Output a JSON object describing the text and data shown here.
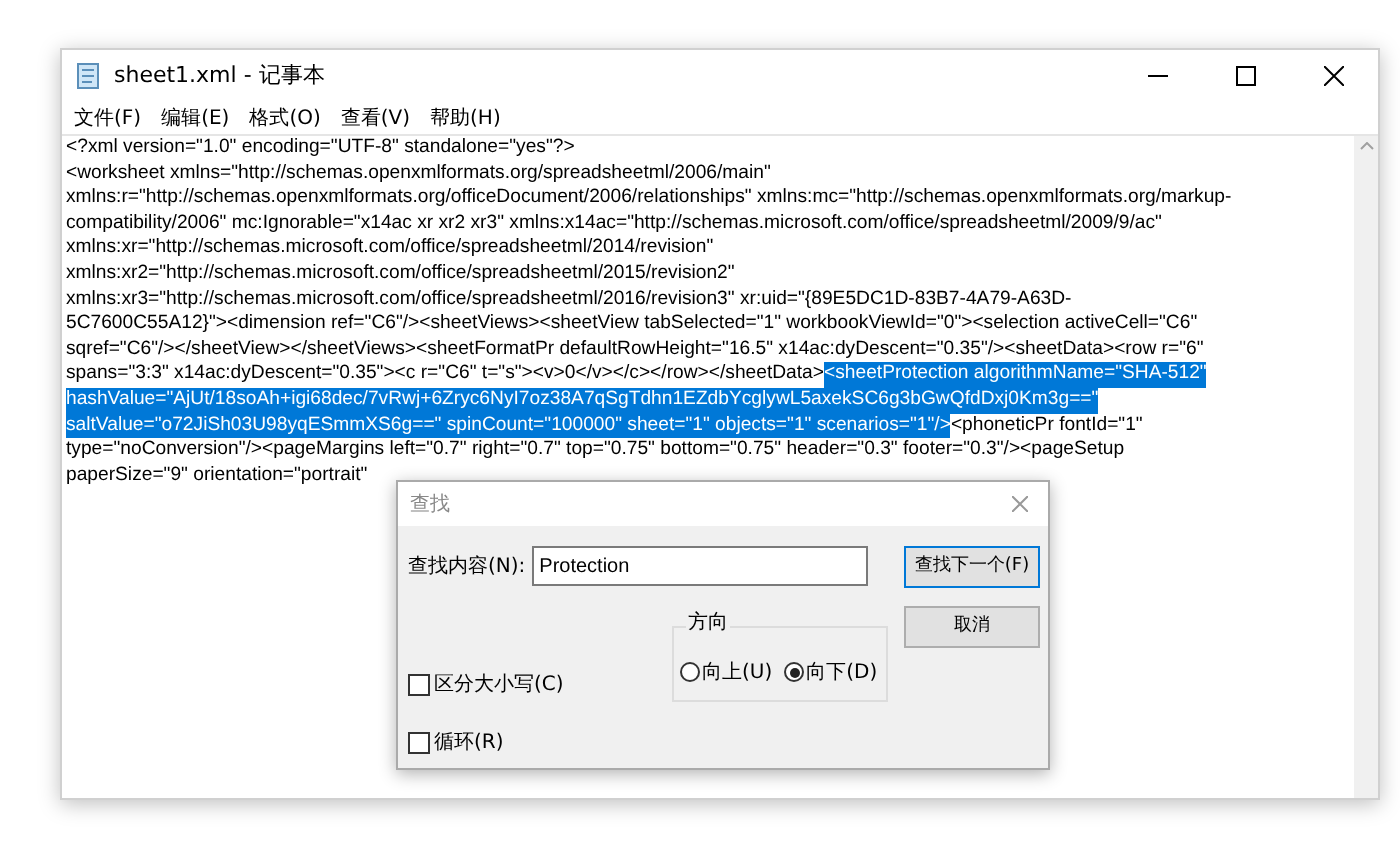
{
  "window": {
    "title": "sheet1.xml - 记事本"
  },
  "menu": [
    "文件(F)",
    "编辑(E)",
    "格式(O)",
    "查看(V)",
    "帮助(H)"
  ],
  "editor": {
    "lines": [
      [
        {
          "text": "<?xml version=\"1.0\" encoding=\"UTF-8\" standalone=\"yes\"?>",
          "selected": false
        }
      ],
      [
        {
          "text": "<worksheet xmlns=\"http://schemas.openxmlformats.org/spreadsheetml/2006/main\"",
          "selected": false
        }
      ],
      [
        {
          "text": "xmlns:r=\"http://schemas.openxmlformats.org/officeDocument/2006/relationships\" xmlns:mc=\"http://schemas.openxmlformats.org/markup-",
          "selected": false
        }
      ],
      [
        {
          "text": "compatibility/2006\" mc:Ignorable=\"x14ac xr xr2 xr3\" xmlns:x14ac=\"http://schemas.microsoft.com/office/spreadsheetml/2009/9/ac\"",
          "selected": false
        }
      ],
      [
        {
          "text": "xmlns:xr=\"http://schemas.microsoft.com/office/spreadsheetml/2014/revision\"",
          "selected": false
        }
      ],
      [
        {
          "text": "xmlns:xr2=\"http://schemas.microsoft.com/office/spreadsheetml/2015/revision2\"",
          "selected": false
        }
      ],
      [
        {
          "text": "xmlns:xr3=\"http://schemas.microsoft.com/office/spreadsheetml/2016/revision3\" xr:uid=\"{89E5DC1D-83B7-4A79-A63D-",
          "selected": false
        }
      ],
      [
        {
          "text": "5C7600C55A12}\"><dimension ref=\"C6\"/><sheetViews><sheetView tabSelected=\"1\" workbookViewId=\"0\"><selection activeCell=\"C6\"",
          "selected": false
        }
      ],
      [
        {
          "text": "sqref=\"C6\"/></sheetView></sheetViews><sheetFormatPr defaultRowHeight=\"16.5\" x14ac:dyDescent=\"0.35\"/><sheetData><row r=\"6\"",
          "selected": false
        }
      ],
      [
        {
          "text": "spans=\"3:3\" x14ac:dyDescent=\"0.35\"><c r=\"C6\" t=\"s\"><v>0</v></c></row></sheetData>",
          "selected": false
        },
        {
          "text": "<sheetProtection algorithmName=\"SHA-512\"",
          "selected": true
        }
      ],
      [
        {
          "text": "hashValue=\"AjUt/18soAh+igi68dec/7vRwj+6Zryc6NyI7oz38A7qSgTdhn1EZdbYcglywL5axekSC6g3bGwQfdDxj0Km3g==\"",
          "selected": true
        }
      ],
      [
        {
          "text": "saltValue=\"o72JiSh03U98yqESmmXS6g==\" spinCount=\"100000\" sheet=\"1\" objects=\"1\" scenarios=\"1\"/>",
          "selected": true
        },
        {
          "text": "<phoneticPr fontId=\"1\"",
          "selected": false
        }
      ],
      [
        {
          "text": "type=\"noConversion\"/><pageMargins left=\"0.7\" right=\"0.7\" top=\"0.75\" bottom=\"0.75\" header=\"0.3\" footer=\"0.3\"/><pageSetup",
          "selected": false
        }
      ],
      [
        {
          "text": "paperSize=\"9\" orientation=\"portrait\"",
          "selected": false
        }
      ]
    ]
  },
  "find_dialog": {
    "title": "查找",
    "find_label": "查找内容(N):",
    "find_value": "Protection",
    "buttons": [
      "查找下一个(F)",
      "取消"
    ],
    "direction": {
      "title": "方向",
      "options": [
        {
          "label": "向上(U)",
          "selected": false
        },
        {
          "label": "向下(D)",
          "selected": true
        }
      ]
    },
    "checkboxes": [
      {
        "label": "区分大小写(C)",
        "checked": false
      },
      {
        "label": "循环(R)",
        "checked": false
      }
    ]
  }
}
